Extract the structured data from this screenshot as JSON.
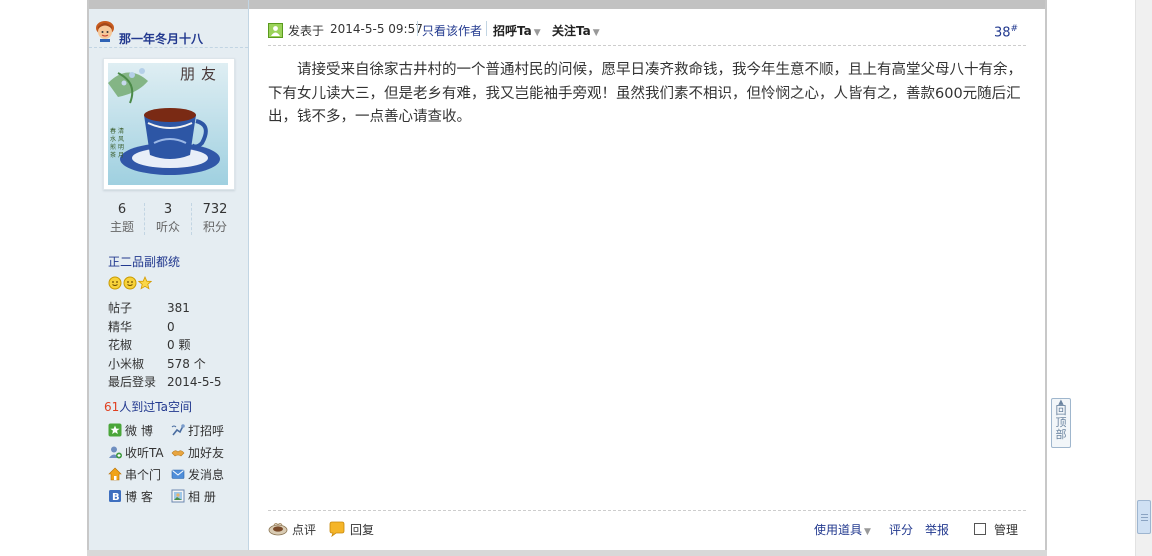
{
  "user": {
    "name": "那一年冬月十八",
    "avatar_caption": "朋友",
    "stats": [
      {
        "value": "6",
        "label": "主题"
      },
      {
        "value": "3",
        "label": "听众"
      },
      {
        "value": "732",
        "label": "积分"
      }
    ],
    "rank": "正二品副都统",
    "info": [
      {
        "key": "帖子",
        "value": "381"
      },
      {
        "key": "精华",
        "value": "0"
      },
      {
        "key": "花椒",
        "value": "0 颗"
      },
      {
        "key": "小米椒",
        "value": "578 个"
      },
      {
        "key": "最后登录",
        "value": "2014-5-5"
      }
    ],
    "visitors_count": "61",
    "visitors_text": "人到过Ta空间",
    "actions": [
      {
        "label": "微 博",
        "icon": "weibo-icon"
      },
      {
        "label": "打招呼",
        "icon": "greet-icon"
      },
      {
        "label": "收听TA",
        "icon": "follow-icon"
      },
      {
        "label": "加好友",
        "icon": "add-friend-icon"
      },
      {
        "label": "串个门",
        "icon": "home-icon"
      },
      {
        "label": "发消息",
        "icon": "message-icon"
      },
      {
        "label": "博 客",
        "icon": "blog-icon"
      },
      {
        "label": "相 册",
        "icon": "album-icon"
      }
    ]
  },
  "post": {
    "posted_label": "发表于",
    "time": "2014-5-5 09:57",
    "only_author": "只看该作者",
    "greet": "招呼Ta",
    "follow": "关注Ta",
    "floor": "38",
    "floor_suffix": "#",
    "body": "请接受来自徐家古井村的一个普通村民的问候，愿早日凑齐救命钱，我今年生意不顺，且上有高堂父母八十有余，下有女儿读大三，但是老乡有难，我又岂能袖手旁观！虽然我们素不相识，但怜悯之心，人皆有之，善款600元随后汇出，钱不多，一点善心请查收。"
  },
  "footer": {
    "comment": "点评",
    "reply": "回复",
    "tools": "使用道具",
    "rate": "评分",
    "report": "举报",
    "manage": "管理"
  },
  "back_to_top": "回顶部",
  "colors": {
    "link": "#22398f",
    "sidebar_bg": "#e5edf2",
    "visitor_count": "#e04020"
  }
}
